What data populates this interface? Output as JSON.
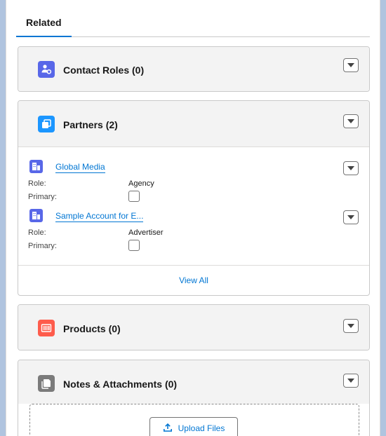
{
  "tabs": {
    "related_label": "Related"
  },
  "cards": {
    "contact_roles": {
      "title": "Contact Roles (0)",
      "icon": "contact-roles-icon",
      "icon_color": "#5867e8"
    },
    "partners": {
      "title": "Partners (2)",
      "icon": "partners-icon",
      "icon_color": "#1b96ff",
      "items": [
        {
          "name": "Global Media",
          "role_label": "Role:",
          "role_value": "Agency",
          "primary_label": "Primary:",
          "primary_checked": false
        },
        {
          "name": "Sample Account for E...",
          "role_label": "Role:",
          "role_value": "Advertiser",
          "primary_label": "Primary:",
          "primary_checked": false
        }
      ],
      "view_all_label": "View All"
    },
    "products": {
      "title": "Products (0)",
      "icon": "products-icon",
      "icon_color": "#fe5c4c"
    },
    "notes_attachments": {
      "title": "Notes & Attachments (0)",
      "icon": "notes-attachments-icon",
      "icon_color": "#7b7b7b",
      "upload_label": "Upload Files"
    }
  },
  "colors": {
    "link": "#0176d3",
    "accent_tab": "#0176d3",
    "background": "#b0c4df"
  }
}
